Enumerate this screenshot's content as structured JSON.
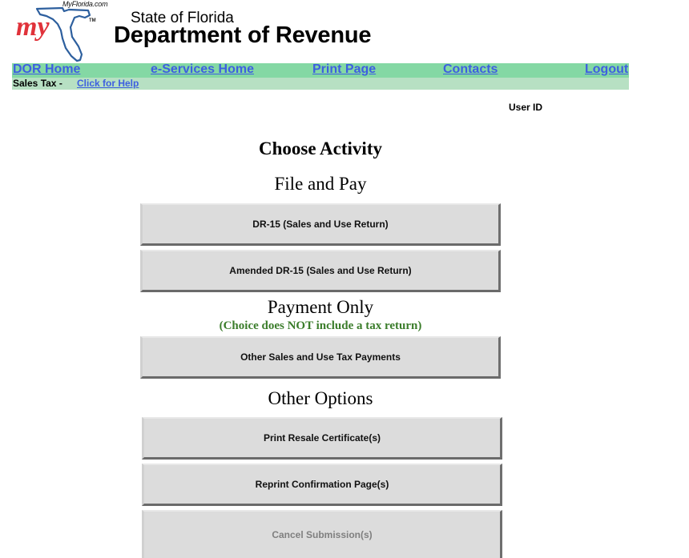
{
  "header": {
    "logo": {
      "site_text": "MyFlorida.com",
      "script_text": "my",
      "trademark": "™",
      "icon": "florida-outline-icon",
      "colors": {
        "script": "#e0323a",
        "outline": "#2d5f9e"
      }
    },
    "subtitle": "State of Florida",
    "title": "Department of Revenue"
  },
  "nav": {
    "links": [
      {
        "label": "DOR Home"
      },
      {
        "label": "e-Services Home"
      },
      {
        "label": "Print Page"
      },
      {
        "label": "Contacts"
      },
      {
        "label": "Logout"
      }
    ],
    "sub": {
      "label": "Sales Tax -",
      "help_link": "Click for Help"
    },
    "colors": {
      "main_bg": "#84d8a4",
      "sub_bg": "#b7e0c3",
      "link": "#3d5fe0"
    }
  },
  "user": {
    "label": "User ID"
  },
  "main": {
    "title": "Choose Activity",
    "sections": [
      {
        "heading": "File and Pay",
        "buttons": [
          {
            "label": "DR-15 (Sales and Use Return)",
            "enabled": true
          },
          {
            "label": "Amended DR-15 (Sales and Use Return)",
            "enabled": true
          }
        ]
      },
      {
        "heading": "Payment Only",
        "note": "(Choice does NOT include a tax return)",
        "note_color": "#3b7d2b",
        "buttons": [
          {
            "label": "Other Sales and Use Tax Payments",
            "enabled": true
          }
        ]
      },
      {
        "heading": "Other Options",
        "buttons": [
          {
            "label": "Print Resale Certificate(s)",
            "enabled": true
          },
          {
            "label": "Reprint Confirmation Page(s)",
            "enabled": true
          },
          {
            "label": "Cancel Submission(s)",
            "enabled": false
          }
        ]
      }
    ]
  }
}
